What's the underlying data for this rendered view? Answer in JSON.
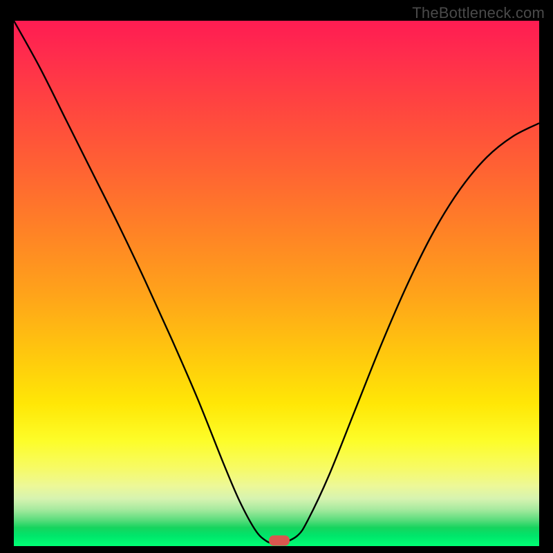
{
  "watermark": "TheBottleneck.com",
  "chart_data": {
    "type": "line",
    "title": "",
    "xlabel": "",
    "ylabel": "",
    "xlim": [
      0,
      1
    ],
    "ylim": [
      0,
      1
    ],
    "grid": false,
    "legend": false,
    "background_gradient": {
      "type": "vertical",
      "stops": [
        {
          "pos": 0.0,
          "color": "#ff1c52"
        },
        {
          "pos": 0.5,
          "color": "#ffa31a"
        },
        {
          "pos": 0.8,
          "color": "#fdfd29"
        },
        {
          "pos": 0.95,
          "color": "#5cdd7d"
        },
        {
          "pos": 1.0,
          "color": "#00ff74"
        }
      ]
    },
    "series": [
      {
        "name": "bottleneck-curve",
        "color": "#000000",
        "x": [
          0.0,
          0.05,
          0.1,
          0.15,
          0.2,
          0.25,
          0.3,
          0.35,
          0.4,
          0.43,
          0.46,
          0.48,
          0.495,
          0.51,
          0.54,
          0.56,
          0.6,
          0.65,
          0.7,
          0.75,
          0.8,
          0.85,
          0.9,
          0.95,
          1.0
        ],
        "y": [
          1.0,
          0.91,
          0.81,
          0.71,
          0.61,
          0.505,
          0.395,
          0.28,
          0.155,
          0.085,
          0.03,
          0.01,
          0.005,
          0.005,
          0.02,
          0.05,
          0.135,
          0.26,
          0.385,
          0.5,
          0.6,
          0.68,
          0.74,
          0.78,
          0.805
        ]
      }
    ],
    "annotations": [
      {
        "name": "min-marker",
        "type": "marker",
        "shape": "rounded-rect",
        "x": 0.505,
        "y": 0.01,
        "color": "#d9574f"
      }
    ]
  }
}
